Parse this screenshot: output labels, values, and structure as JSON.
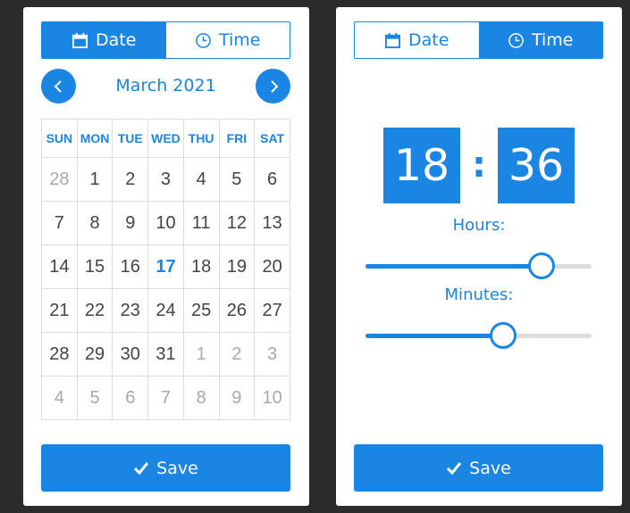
{
  "date_picker": {
    "tabs": {
      "date_label": "Date",
      "time_label": "Time",
      "date_icon": "calendar-icon",
      "time_icon": "clock-icon"
    },
    "month_title": "March 2021",
    "prev_icon": "chevron-left-icon",
    "next_icon": "chevron-right-icon",
    "weekdays": [
      "SUN",
      "MON",
      "TUE",
      "WED",
      "THU",
      "FRI",
      "SAT"
    ],
    "weeks": [
      [
        "28",
        "1",
        "2",
        "3",
        "4",
        "5",
        "6"
      ],
      [
        "7",
        "8",
        "9",
        "10",
        "11",
        "12",
        "13"
      ],
      [
        "14",
        "15",
        "16",
        "17",
        "18",
        "19",
        "20"
      ],
      [
        "21",
        "22",
        "23",
        "24",
        "25",
        "26",
        "27"
      ],
      [
        "28",
        "29",
        "30",
        "31",
        "1",
        "2",
        "3"
      ],
      [
        "4",
        "5",
        "6",
        "7",
        "8",
        "9",
        "10"
      ]
    ],
    "selected_day": "17",
    "save_label": "Save",
    "save_icon": "checkmark-icon"
  },
  "time_picker": {
    "tabs": {
      "date_label": "Date",
      "time_label": "Time",
      "date_icon": "calendar-icon",
      "time_icon": "clock-icon"
    },
    "hours": "18",
    "separator": ":",
    "minutes": "36",
    "hours_label": "Hours:",
    "minutes_label": "Minutes:",
    "hours_slider_fraction": 0.78,
    "minutes_slider_fraction": 0.61,
    "save_label": "Save",
    "save_icon": "checkmark-icon"
  },
  "colors": {
    "accent": "#1a85e2",
    "background": "#2b2b2b",
    "card": "#ffffff",
    "muted_text": "#a8a8a8",
    "body_text": "#444444"
  }
}
